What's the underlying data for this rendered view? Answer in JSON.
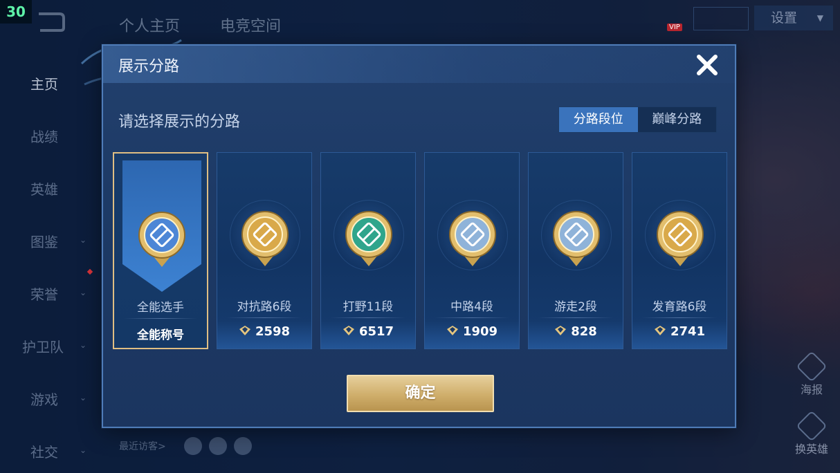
{
  "fps": "30",
  "top_nav": [
    "个人主页",
    "电竞空间"
  ],
  "settings_label": "设置",
  "vip_badge": "VIP",
  "sidebar": [
    {
      "label": "主页",
      "active": true
    },
    {
      "label": "战绩"
    },
    {
      "label": "英雄"
    },
    {
      "label": "图鉴",
      "chevron": true
    },
    {
      "label": "荣誉",
      "chevron": true
    },
    {
      "label": "护卫队",
      "chevron": true
    },
    {
      "label": "游戏",
      "chevron": true
    },
    {
      "label": "社交",
      "chevron": true
    }
  ],
  "visitors_label": "最近访客>",
  "right_actions": {
    "poster": "海报",
    "swap_hero": "换英雄"
  },
  "modal": {
    "title": "展示分路",
    "subtitle": "请选择展示的分路",
    "tabs": [
      {
        "label": "分路段位",
        "active": true
      },
      {
        "label": "巅峰分路",
        "active": false
      }
    ],
    "cards": [
      {
        "name": "全能选手",
        "value": "全能称号",
        "selected": true,
        "icon": "allround-emblem-icon",
        "color": "#4d86d6"
      },
      {
        "name": "对抗路6段",
        "value": "2598",
        "icon": "clash-lane-emblem-icon",
        "color": "#d9a94a"
      },
      {
        "name": "打野11段",
        "value": "6517",
        "icon": "jungle-emblem-icon",
        "color": "#2fa58c"
      },
      {
        "name": "中路4段",
        "value": "1909",
        "icon": "mid-lane-emblem-icon",
        "color": "#8fb3d9"
      },
      {
        "name": "游走2段",
        "value": "828",
        "icon": "roam-emblem-icon",
        "color": "#8fb3d9"
      },
      {
        "name": "发育路6段",
        "value": "2741",
        "icon": "farm-lane-emblem-icon",
        "color": "#d9a94a"
      }
    ],
    "confirm_label": "确定"
  },
  "colors": {
    "gold": "#e0bf83",
    "accent_blue": "#3a73bc",
    "modal_bg": "#1d3a66"
  }
}
